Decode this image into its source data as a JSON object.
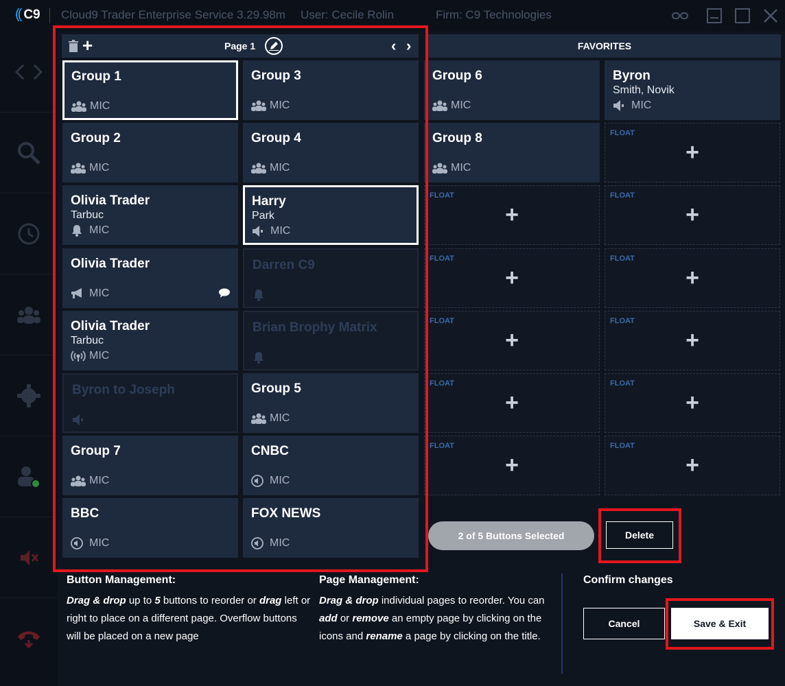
{
  "titlebar": {
    "logo": "C9",
    "service": "Cloud9 Trader Enterprise Service  3.29.98m",
    "user": "User: Cecile Rolin",
    "firm": "Firm: C9 Technologies"
  },
  "page_panel": {
    "title": "Page 1",
    "buttons": [
      {
        "name": "Group 1",
        "sub": "",
        "mic": "MIC",
        "icon": "group-icon",
        "state": "selected"
      },
      {
        "name": "Group 3",
        "sub": "",
        "mic": "MIC",
        "icon": "group-icon",
        "state": "normal"
      },
      {
        "name": "Group 2",
        "sub": "",
        "mic": "MIC",
        "icon": "group-icon",
        "state": "normal"
      },
      {
        "name": "Group 4",
        "sub": "",
        "mic": "MIC",
        "icon": "group-icon",
        "state": "normal"
      },
      {
        "name": "Olivia Trader",
        "sub": "Tarbuc",
        "mic": "MIC",
        "icon": "bell-icon",
        "state": "normal"
      },
      {
        "name": "Harry",
        "sub": "Park",
        "mic": "MIC",
        "icon": "speaker-icon",
        "state": "selected"
      },
      {
        "name": "Olivia Trader",
        "sub": "",
        "mic": "MIC",
        "icon": "megaphone-icon",
        "state": "normal",
        "bubble": true
      },
      {
        "name": "Darren C9",
        "sub": "",
        "mic": "",
        "icon": "bell-icon",
        "state": "dim"
      },
      {
        "name": "Olivia Trader",
        "sub": "Tarbuc",
        "mic": "MIC",
        "icon": "broadcast-icon",
        "state": "normal"
      },
      {
        "name": "Brian Brophy Matrix",
        "sub": "",
        "mic": "",
        "icon": "bell-icon",
        "state": "dim"
      },
      {
        "name": "Byron to Joseph",
        "sub": "",
        "mic": "",
        "icon": "speaker-icon",
        "state": "dim"
      },
      {
        "name": "Group 5",
        "sub": "",
        "mic": "MIC",
        "icon": "group-icon",
        "state": "normal"
      },
      {
        "name": "Group 7",
        "sub": "",
        "mic": "MIC",
        "icon": "group-icon",
        "state": "normal"
      },
      {
        "name": "CNBC",
        "sub": "",
        "mic": "MIC",
        "icon": "audio-circle-icon",
        "state": "normal"
      },
      {
        "name": "BBC",
        "sub": "",
        "mic": "MIC",
        "icon": "audio-circle-icon",
        "state": "normal"
      },
      {
        "name": "FOX NEWS",
        "sub": "",
        "mic": "MIC",
        "icon": "audio-circle-icon",
        "state": "normal"
      }
    ]
  },
  "favorites": {
    "title": "FAVORITES",
    "buttons": [
      {
        "name": "Group 6",
        "sub": "",
        "mic": "MIC",
        "icon": "group-icon"
      },
      {
        "name": "Byron",
        "sub": "Smith, Novik",
        "mic": "MIC",
        "icon": "speaker-icon"
      },
      {
        "name": "Group 8",
        "sub": "",
        "mic": "MIC",
        "icon": "group-icon"
      }
    ],
    "float_label": "FLOAT",
    "float_slots": 11
  },
  "selection": {
    "status": "2 of 5 Buttons Selected",
    "delete_label": "Delete"
  },
  "help": {
    "button_mgmt_title": "Button Management:",
    "page_mgmt_title": "Page Management:",
    "confirm_title": "Confirm changes"
  },
  "actions": {
    "cancel_label": "Cancel",
    "save_label": "Save & Exit"
  },
  "colors": {
    "background": "#0f151f",
    "card": "#1e2a3e",
    "highlight": "#e1171e",
    "accent": "#2aa6ff",
    "float_label": "#3d6aa8"
  }
}
